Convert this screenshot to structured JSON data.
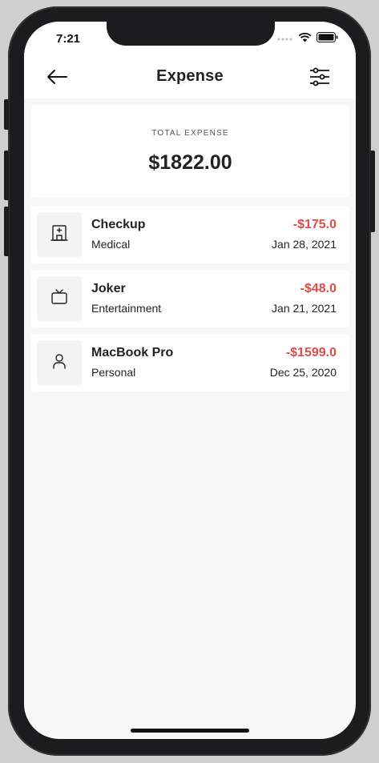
{
  "status_bar": {
    "time": "7:21"
  },
  "header": {
    "title": "Expense"
  },
  "summary": {
    "label": "TOTAL EXPENSE",
    "value": "$1822.00"
  },
  "transactions": [
    {
      "title": "Checkup",
      "category": "Medical",
      "amount": "-$175.0",
      "date": "Jan 28, 2021",
      "icon": "hospital-icon"
    },
    {
      "title": "Joker",
      "category": "Entertainment",
      "amount": "-$48.0",
      "date": "Jan 21, 2021",
      "icon": "tv-icon"
    },
    {
      "title": "MacBook Pro",
      "category": "Personal",
      "amount": "-$1599.0",
      "date": "Dec 25, 2020",
      "icon": "person-icon"
    }
  ],
  "colors": {
    "negative_amount": "#e04b4b",
    "background": "#f7f7f7",
    "card": "#ffffff"
  }
}
